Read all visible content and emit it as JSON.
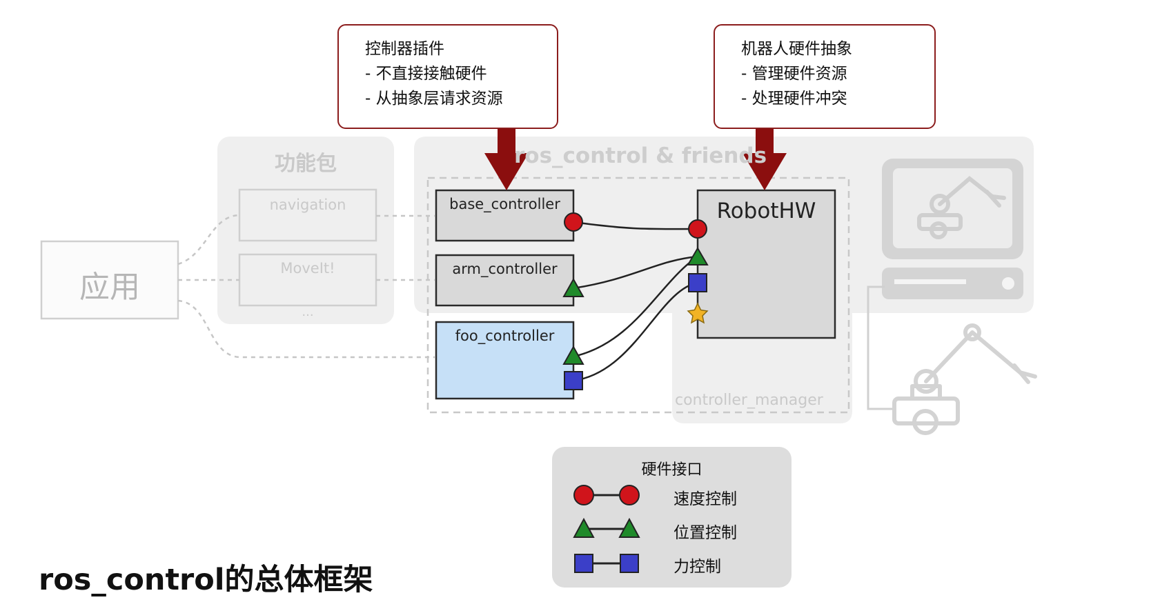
{
  "page_title": "ros_control的总体框架",
  "application": {
    "label": "应用"
  },
  "packages": {
    "title": "功能包",
    "items": [
      "navigation",
      "MoveIt!",
      "..."
    ]
  },
  "framework": {
    "title": "ros_control & friends",
    "manager_label": "controller_manager"
  },
  "controllers": [
    {
      "label": "base_controller"
    },
    {
      "label": "arm_controller"
    },
    {
      "label": "foo_controller"
    }
  ],
  "robot_hw": {
    "label": "RobotHW"
  },
  "callouts": {
    "controller": {
      "title": "控制器插件",
      "lines": [
        "- 不直接接触硬件",
        "- 从抽象层请求资源"
      ]
    },
    "hardware": {
      "title": "机器人硬件抽象",
      "lines": [
        "- 管理硬件资源",
        "- 处理硬件冲突"
      ]
    }
  },
  "legend": {
    "title": "硬件接口",
    "items": [
      {
        "shape": "circle",
        "label": "速度控制",
        "color": "#d0141b"
      },
      {
        "shape": "triangle",
        "label": "位置控制",
        "color": "#1f8a2a"
      },
      {
        "shape": "square",
        "label": "力控制",
        "color": "#3b3fc8"
      }
    ]
  },
  "colors": {
    "callout_border": "#8b1c1c",
    "arrow": "#8b0e0e",
    "foo_controller_fill": "#c6e0f7",
    "star": "#f2b325"
  }
}
